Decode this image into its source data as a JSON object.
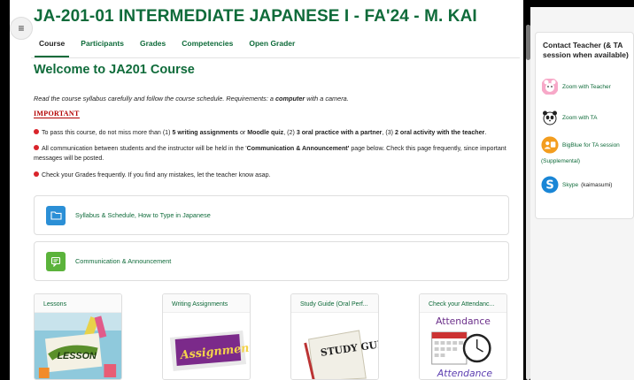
{
  "course": {
    "title": "JA-201-01 INTERMEDIATE JAPANESE I - FA'24 - M. KAI",
    "tabs": [
      "Course",
      "Participants",
      "Grades",
      "Competencies",
      "Open Grader"
    ]
  },
  "content": {
    "welcome": "Welcome to JA201 Course",
    "intro_prefix": "Read the course syllabus carefully and follow the course schedule.  Requirements: a ",
    "intro_bold": "computer",
    "intro_suffix": " with a camera.",
    "important": "IMPORTANT",
    "rule1": {
      "t1": "To pass this course, do not miss more than (1) ",
      "b1": "5 writing assignments",
      "t2": " or ",
      "b2": "Moodle quiz",
      "t3": ", (2) ",
      "b3": "3 oral practice with a partner",
      "t4": ", (3) ",
      "b4": "2 oral activity with the teacher",
      "t5": "."
    },
    "rule2": {
      "t1": "All communication between students and the instructor will be held in the '",
      "b1": "Communication & Announcement'",
      "t2": " page below. Check this page frequently, since important messages will be posted."
    },
    "rule3": "Check your Grades frequently. If you find any mistakes, let the teacher know asap."
  },
  "resources": [
    {
      "label": "Syllabus & Schedule, How to Type in Japanese",
      "icon": "folder-icon",
      "color": "#2b8fd6"
    },
    {
      "label": "Communication & Announcement",
      "icon": "forum-icon",
      "color": "#5bb33b"
    }
  ],
  "cards": [
    {
      "title": "Lessons",
      "image_text": "LESSON"
    },
    {
      "title": "Writing Assignments",
      "image_text": "Assignment"
    },
    {
      "title": "Study Guide (Oral Perf...",
      "image_text": "STUDY GUIDE"
    },
    {
      "title": "Check your Attendanc...",
      "image_text_top": "Attendance",
      "image_text_bottom": "Attendance"
    }
  ],
  "sidebar": {
    "title": "Contact Teacher (& TA session when available)",
    "links": [
      {
        "label": "Zoom with Teacher",
        "icon": "zoom-teacher-icon"
      },
      {
        "label": "Zoom with TA",
        "icon": "panda-icon"
      },
      {
        "label": "BigBlue for TA session",
        "label2": "(Supplemental)",
        "icon": "bigbluebutton-icon"
      },
      {
        "label": "Skype",
        "label2": "(kaimasumi)",
        "icon": "skype-icon"
      }
    ]
  },
  "colors": {
    "accent": "#0f6b3a",
    "important_red": "#b30000",
    "bullet_red": "#d9242b",
    "folder_blue": "#2b8fd6",
    "forum_green": "#5bb33b"
  }
}
